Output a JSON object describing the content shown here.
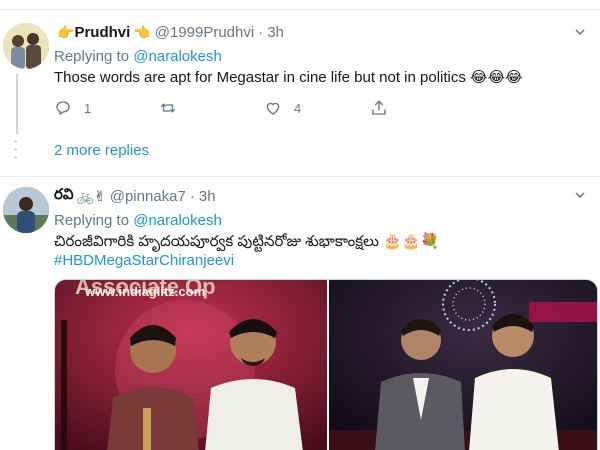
{
  "tweet1": {
    "name": "Prudhvi",
    "name_emoji_left": "👉",
    "name_emoji_right": "👈",
    "handle": "@1999Prudhvi",
    "separator": "·",
    "time": "3h",
    "replying_prefix": "Replying to ",
    "replying_to": "@naralokesh",
    "text": "Those words are apt for Megastar in cine life but not in politics 😂😂😂",
    "reply_count": "1",
    "like_count": "4"
  },
  "more_replies": "2 more replies",
  "tweet2": {
    "name": "రవి",
    "name_emoji": "🚲✌",
    "handle": "@pinnaka7",
    "separator": "·",
    "time": "3h",
    "replying_prefix": "Replying to ",
    "replying_to": "@naralokesh",
    "text": "చిరంజీవిగారికి హృదయపూర్వక పుట్టినరోజు శుభాకాంక్షలు 🎂🎂💐",
    "hashtag": "#HBDMegaStarChiranjeevi",
    "media_watermark": "www.indiaglitz.com"
  },
  "colors": {
    "link": "#1b95e0",
    "muted": "#657786",
    "border": "#e6ecf0"
  }
}
